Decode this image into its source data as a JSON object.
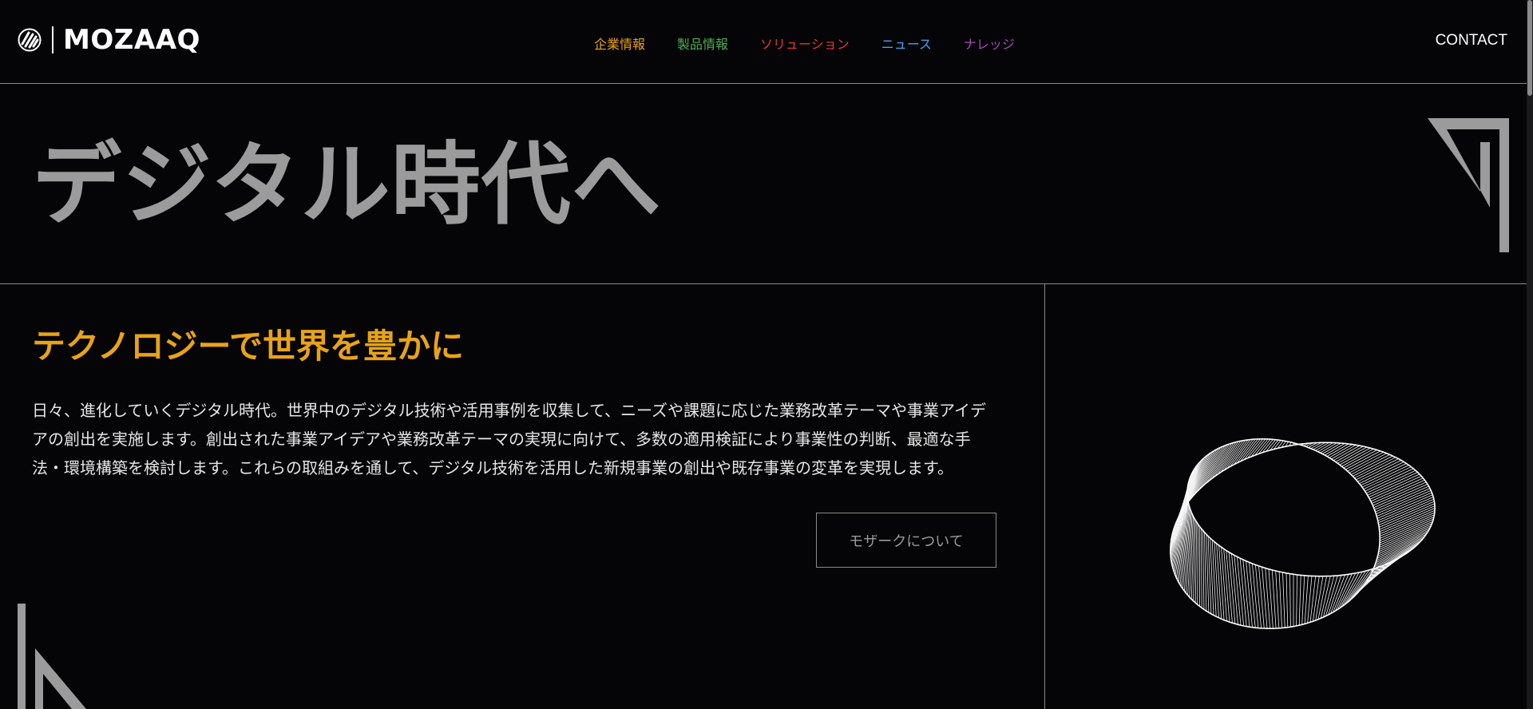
{
  "header": {
    "logo_text": "MOZAAQ",
    "nav": [
      {
        "label": "企業情報",
        "color": "#e8a316"
      },
      {
        "label": "製品情報",
        "color": "#4caf50"
      },
      {
        "label": "ソリューション",
        "color": "#e53935"
      },
      {
        "label": "ニュース",
        "color": "#42a5f5"
      },
      {
        "label": "ナレッジ",
        "color": "#ab47bc"
      }
    ],
    "contact_label": "CONTACT"
  },
  "hero": {
    "title": "デジタル時代へ"
  },
  "content": {
    "tagline": "テクノロジーで世界を豊かに",
    "body": "日々、進化していくデジタル時代。世界中のデジタル技術や活用事例を収集して、ニーズや課題に応じた業務改革テーマや事業アイデアの創出を実施します。創出された事業アイデアや業務改革テーマの実現に向けて、多数の適用検証により事業性の判断、最適な手法・環境構築を検討します。これらの取組みを通して、デジタル技術を活用した新規事業の創出や既存事業の変革を実現します。",
    "about_button": "モザークについて"
  },
  "colors": {
    "background": "#050406",
    "accent_yellow": "#e8a316",
    "title_gray": "#9b9b9b"
  },
  "icons": {
    "logo_mark": "mozaaq-logo-icon",
    "decoration_top_right": "angular-corner-decoration",
    "decoration_bottom_left": "angular-corner-decoration",
    "illustration": "mobius-ring-wireframe"
  }
}
